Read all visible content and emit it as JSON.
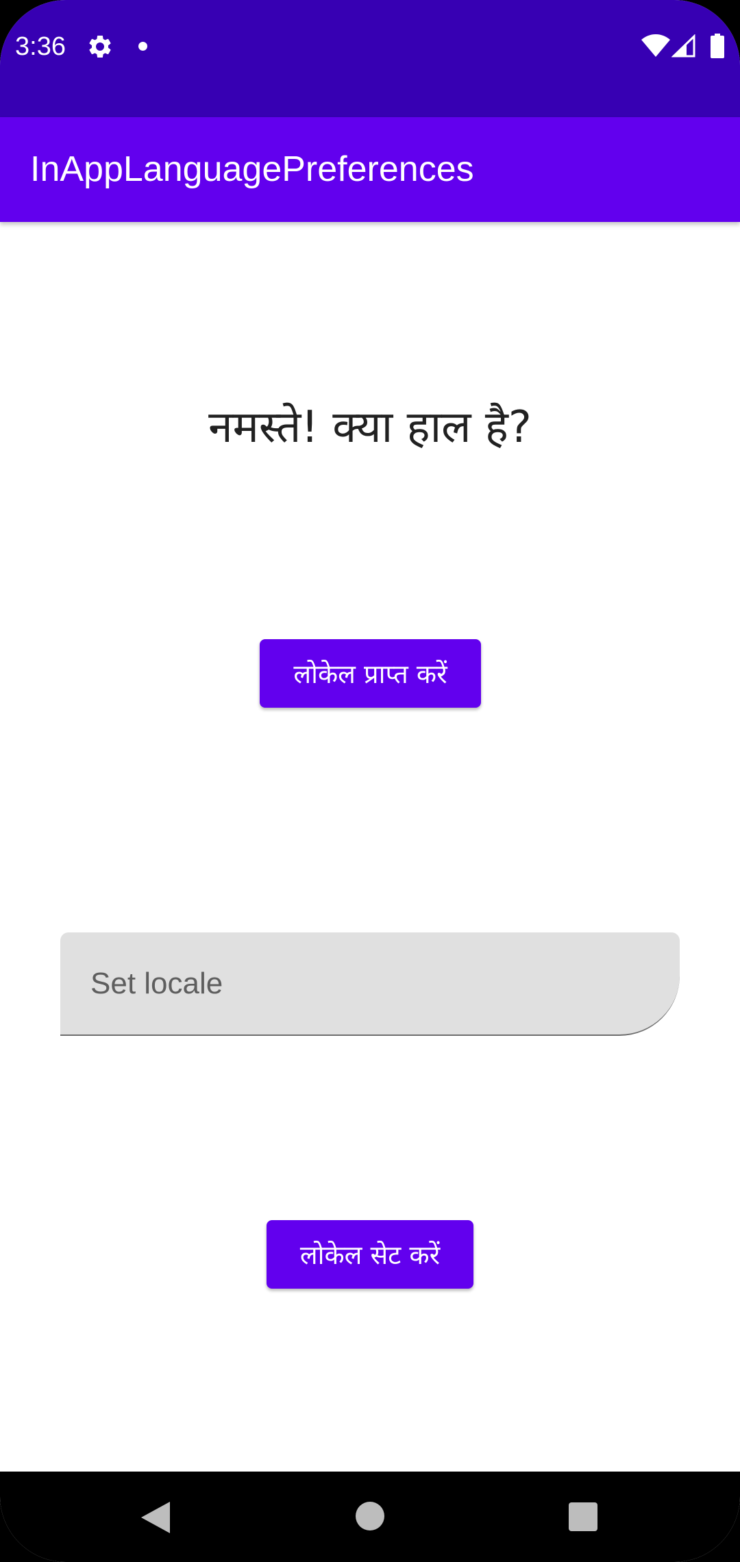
{
  "status_bar": {
    "time": "3:36",
    "icons": [
      "gear-icon",
      "notification-dot-icon",
      "wifi-icon",
      "cell-signal-icon",
      "battery-icon"
    ]
  },
  "app_bar": {
    "title": "InAppLanguagePreferences"
  },
  "main": {
    "greeting": "नमस्ते! क्या हाल है?",
    "get_locale_button": "लोकेल प्राप्त करें",
    "locale_input": {
      "value": "",
      "placeholder": "Set locale"
    },
    "set_locale_button": "लोकेल सेट करें"
  },
  "nav_bar": {
    "icons": [
      "back-icon",
      "home-icon",
      "recents-icon"
    ]
  },
  "colors": {
    "status_bar": "#3700B3",
    "primary": "#6200EE",
    "field_background": "#E0E0E0",
    "nav_bar": "#000000"
  }
}
